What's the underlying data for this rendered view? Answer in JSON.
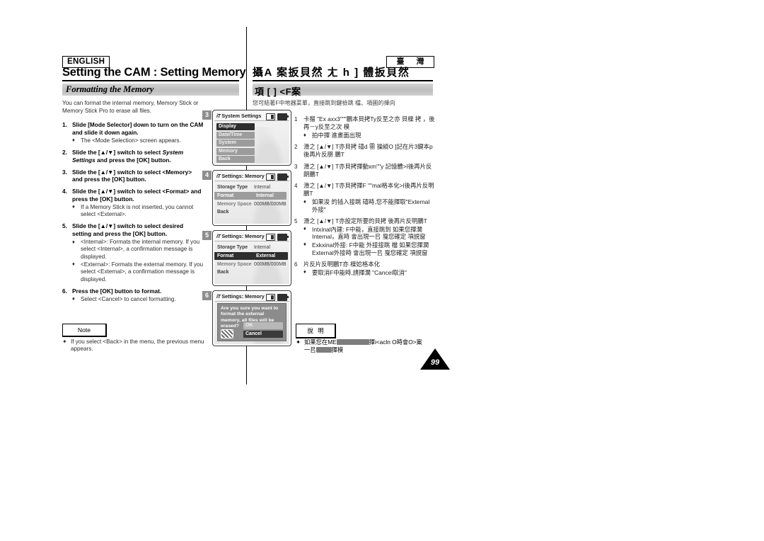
{
  "header": {
    "language_badge": "ENGLISH",
    "region_badge": "臺 灣",
    "title_en": "Setting the CAM : Setting Memory",
    "title_cn": "攝A 案扳貝然 ㄤ h ] 體扳貝然",
    "section_en": "Formatting the Memory",
    "section_cn": "項 [ ] <F案"
  },
  "english": {
    "intro": "You can format the internal memory, Memory Stick or Memory Stick Pro to erase all files.",
    "steps": [
      {
        "num": "1.",
        "text": "Slide [Mode Selector] down to turn on the CAM and slide it down again.",
        "bullets": [
          "The <Mode Selection> screen appears."
        ]
      },
      {
        "num": "2.",
        "text_parts": [
          {
            "t": "Slide the [",
            "style": "bold"
          },
          {
            "t": "▲/▼",
            "style": "bold"
          },
          {
            "t": "] switch to select ",
            "style": "bold"
          },
          {
            "t": "System Settings",
            "style": "bold-italic"
          },
          {
            "t": " and press the [OK] button.",
            "style": "bold"
          }
        ],
        "bullets": []
      },
      {
        "num": "3.",
        "text": "Slide the [▲/▼] switch to select <Memory> and press the [OK] button.",
        "bullets": []
      },
      {
        "num": "4.",
        "text": "Slide the [▲/▼] switch to select <Format> and press the [OK] button.",
        "bullets": [
          "If a Memory Stick is not inserted, you cannot select <External>."
        ]
      },
      {
        "num": "5.",
        "text": "Slide the [▲/▼] switch to select desired setting and press the [OK] button.",
        "bullets": [
          "<Internal>: Formats the internal memory. If you select  <Internal>, a confirmation message is displayed.",
          "<External>: Formats the external memory. If you select <External>, a confirmation message is displayed."
        ]
      },
      {
        "num": "6.",
        "text": "Press the [OK] button to format.",
        "bullets": [
          "Select <Cancel> to cancel formatting."
        ]
      }
    ],
    "note_label": "Note",
    "note_text": "If you select <Back> in the menu, the previous menu appears."
  },
  "chinese": {
    "intro": "您可結著F中地器菜單，直接跳到鍵檢跳 檔、項圃的揮向",
    "steps": [
      {
        "num": "1",
        "text": "卡㨨 \"Ex axx3\"\"\"鵬本貝拷Ty反至之亦 貝檪 拷 ，後再－y反至之次 模",
        "bullets": [
          "拍中揮 進畫面出現"
        ]
      },
      {
        "num": "2",
        "text": "滑之 [▲/▼] T亦貝拷 礂d 霛 操縱O ]記在片3鍵本p 後再片反朋 鵬T",
        "bullets": []
      },
      {
        "num": "3",
        "text": "滑之 [▲/▼] T亦貝拷揮動xm\"\"y 記憶體>I後再片反朗鵬T",
        "bullets": []
      },
      {
        "num": "4",
        "text": "滑之 [▲/▼] T亦貝拷揮F \"\"mal格本化>I後再片反明鵬T",
        "bullets": [
          "如果浚 的插入接跳 礂時,您不能揮取\"External 外接\""
        ]
      },
      {
        "num": "5",
        "text": "滑之 [▲/▼] T亦設定所要的貝拷 後再片反明鵬T",
        "bullets": [
          "Intxinal內建: F中能，直接跳到 如果您揮濶 Internal，直時 會出現一㠯 戛您確定 項誢窗",
          "Exkxinal外接: F中能 外接接跳 檔 如果您揮濶External外接時 會出現一㠯 戛您確定 項誢窗"
        ]
      },
      {
        "num": "6",
        "text": "片反片反明鵬T亦 檪姶格本化",
        "bullets": [
          "要取消F中能時,請揮濶 \"Cancel取消\""
        ]
      }
    ],
    "note_label": "說 明",
    "note_text_a": "如果您在ME",
    "note_text_b": "揮i<acln O時會O>案",
    "note_text_c": "一㠯",
    "note_text_d": "揮模"
  },
  "page_number": "99",
  "screenshots": [
    {
      "step": "3",
      "type": "menu",
      "title": "System Settings",
      "title_icon": "iT",
      "icons": [
        "memory-card-icon",
        "battery-icon"
      ],
      "rows": [
        {
          "label": "Display",
          "selected": true
        },
        {
          "label": "Date/Time",
          "selected": false
        },
        {
          "label": "System",
          "selected": false
        },
        {
          "label": "Memory",
          "selected": false
        },
        {
          "label": "Back",
          "selected": false
        }
      ]
    },
    {
      "step": "4",
      "type": "settings",
      "title": "Settings: Memory",
      "title_icon": "iT",
      "icons": [
        "memory-card-icon",
        "battery-icon"
      ],
      "rows": [
        {
          "label": "Storage Type",
          "value": "Internal",
          "highlight": false,
          "muted": false
        },
        {
          "label": "Format",
          "value": "Internal",
          "highlight": true,
          "grey": true,
          "muted": false
        },
        {
          "label": "Memory Space",
          "value": "000MB/000MB",
          "highlight": false,
          "muted": true
        }
      ],
      "back": "Back"
    },
    {
      "step": "5",
      "type": "settings",
      "title": "Settings: Memory",
      "title_icon": "iT",
      "icons": [
        "memory-card-icon",
        "battery-icon"
      ],
      "rows": [
        {
          "label": "Storage Type",
          "value": "Internal",
          "highlight": false,
          "muted": false
        },
        {
          "label": "Format",
          "value": "External",
          "highlight": true,
          "grey": false,
          "muted": false
        },
        {
          "label": "Memory Space",
          "value": "000MB/000MB",
          "highlight": false,
          "muted": true
        }
      ],
      "back": "Back"
    },
    {
      "step": "6",
      "type": "dialog",
      "title": "Settings: Memory",
      "title_icon": "iT",
      "icons": [
        "memory-card-icon",
        "battery-icon"
      ],
      "message": "Are you sure you want to format the external memory, all files will be erased?",
      "buttons": [
        {
          "label": "OK",
          "selected": false
        },
        {
          "label": "Cancel",
          "selected": true
        }
      ],
      "dialog_icon": "no-entry-icon"
    }
  ]
}
